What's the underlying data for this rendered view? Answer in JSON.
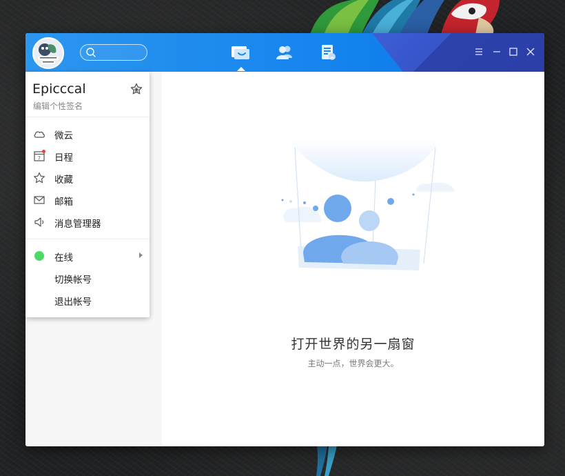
{
  "search": {
    "placeholder": "",
    "value": ""
  },
  "nav_tabs": [
    {
      "id": "messages",
      "icon": "chat-bubble-icon",
      "active": true
    },
    {
      "id": "contacts",
      "icon": "contacts-icon",
      "active": false
    },
    {
      "id": "groups",
      "icon": "document-icon",
      "active": false
    }
  ],
  "window_controls": [
    "menu-icon",
    "minimize-icon",
    "maximize-icon",
    "close-icon"
  ],
  "profile_menu": {
    "username": "Epicccal",
    "signature": "编辑个性签名",
    "items": [
      {
        "label": "微云",
        "icon": "cloud-icon"
      },
      {
        "label": "日程",
        "icon": "calendar-icon",
        "badge": true
      },
      {
        "label": "收藏",
        "icon": "star-icon"
      },
      {
        "label": "邮箱",
        "icon": "mail-icon"
      },
      {
        "label": "消息管理器",
        "icon": "speaker-icon"
      }
    ],
    "status": {
      "label": "在线",
      "color": "#4cd964"
    },
    "switch_account": "切换帐号",
    "logout": "退出帐号",
    "calendar_day": "7"
  },
  "empty_state": {
    "title": "打开世界的另一扇窗",
    "subtitle": "主动一点，世界会更大。"
  },
  "colors": {
    "accent": "#1a88ee",
    "online": "#4cd964",
    "badge": "#ff3b30"
  }
}
